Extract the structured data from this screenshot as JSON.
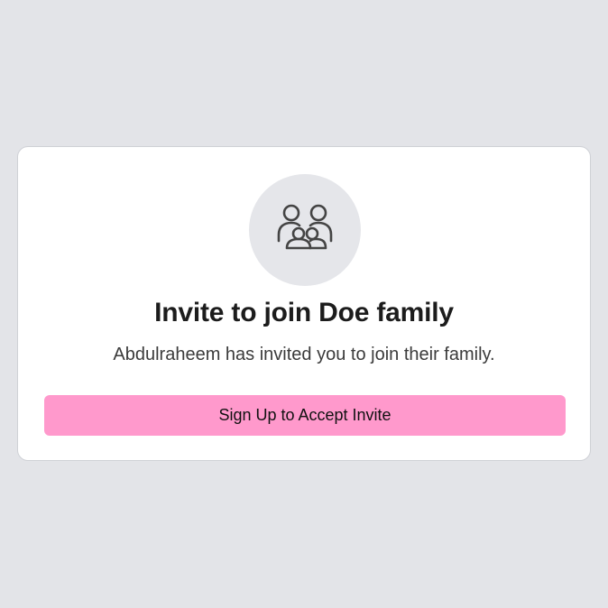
{
  "invite": {
    "icon": "family-icon",
    "title": "Invite to join Doe family",
    "message": "Abdulraheem has invited you to join their family.",
    "accept_label": "Sign Up to Accept Invite"
  },
  "colors": {
    "background": "#e3e4e8",
    "card": "#ffffff",
    "accent_button": "#ff99cc",
    "avatar_circle": "#e5e6ea"
  }
}
